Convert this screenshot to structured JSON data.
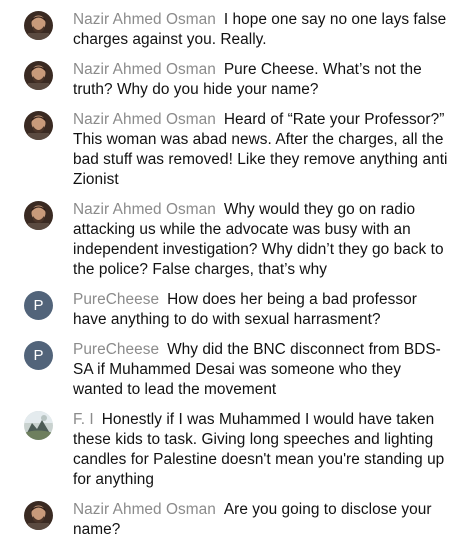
{
  "messages": [
    {
      "author": "Nazir Ahmed Osman",
      "avatar_type": "photo",
      "text": "I hope one say no one lays false charges against you. Really."
    },
    {
      "author": "Nazir Ahmed Osman",
      "avatar_type": "photo",
      "text": "Pure Cheese. What’s not the truth? Why do you hide your name?"
    },
    {
      "author": "Nazir Ahmed Osman",
      "avatar_type": "photo",
      "text": "Heard of “Rate your Professor?” This woman was abad news. After the charges, all the bad stuff was removed! Like they remove anything anti Zionist"
    },
    {
      "author": "Nazir Ahmed Osman",
      "avatar_type": "photo",
      "text": "Why would they go on radio attacking us while the advocate was busy with an independent investigation? Why didn’t they go back to the police? False charges, that’s why"
    },
    {
      "author": "PureCheese",
      "avatar_type": "letter",
      "avatar_letter": "P",
      "avatar_color": "#52647a",
      "text": "How does her being a bad professor have anything to do with sexual harrasment?"
    },
    {
      "author": "PureCheese",
      "avatar_type": "letter",
      "avatar_letter": "P",
      "avatar_color": "#52647a",
      "text": "Why did the BNC disconnect from BDS-SA if Muhammed Desai was someone who they wanted to lead the movement"
    },
    {
      "author": "F. I",
      "avatar_type": "photo-landscape",
      "text": "Honestly if I was Muhammed I would have taken these kids to task. Giving long speeches and lighting candles for Palestine doesn't mean you're standing up for anything"
    },
    {
      "author": "Nazir Ahmed Osman",
      "avatar_type": "photo",
      "text": "Are you going to disclose your name?"
    }
  ],
  "colors": {
    "author": "#8b8b8b",
    "text": "#111111",
    "background": "#ffffff"
  }
}
